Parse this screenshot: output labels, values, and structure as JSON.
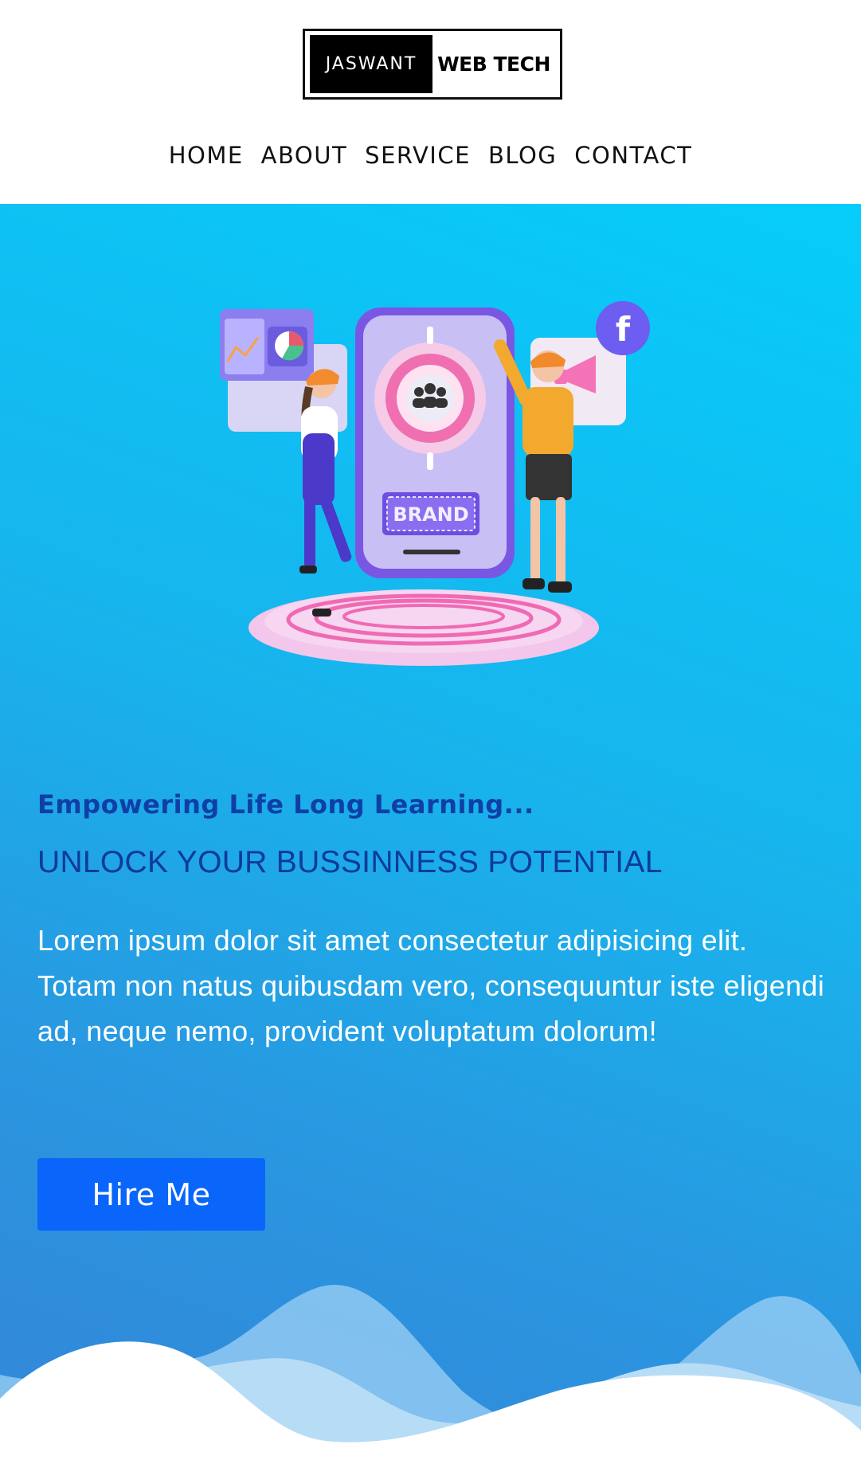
{
  "logo": {
    "left_text": "JASWANT",
    "right_text": "WEB TECH"
  },
  "nav": {
    "items": [
      {
        "label": "HOME"
      },
      {
        "label": "ABOUT"
      },
      {
        "label": "SERVICE"
      },
      {
        "label": "BLOG"
      },
      {
        "label": "CONTACT"
      }
    ]
  },
  "hero": {
    "illustration_badge": "BRAND",
    "tagline": "Empowering Life Long Learning...",
    "headline": "UNLOCK YOUR BUSSINNESS POTENTIAL",
    "description": "Lorem ipsum dolor sit amet consectetur adipisicing elit. Totam non natus quibusdam vero, consequuntur iste eligendi ad, neque nemo, provident voluptatum dolorum!",
    "cta_label": "Hire Me"
  },
  "colors": {
    "hero_gradient_top": "#06cdfb",
    "hero_gradient_bottom": "#3486d8",
    "headline": "#0d3a9e",
    "cta_button": "#0a65fb"
  },
  "icons": [
    "facebook-icon",
    "megaphone-icon",
    "users-icon",
    "analytics-chart-icon"
  ]
}
